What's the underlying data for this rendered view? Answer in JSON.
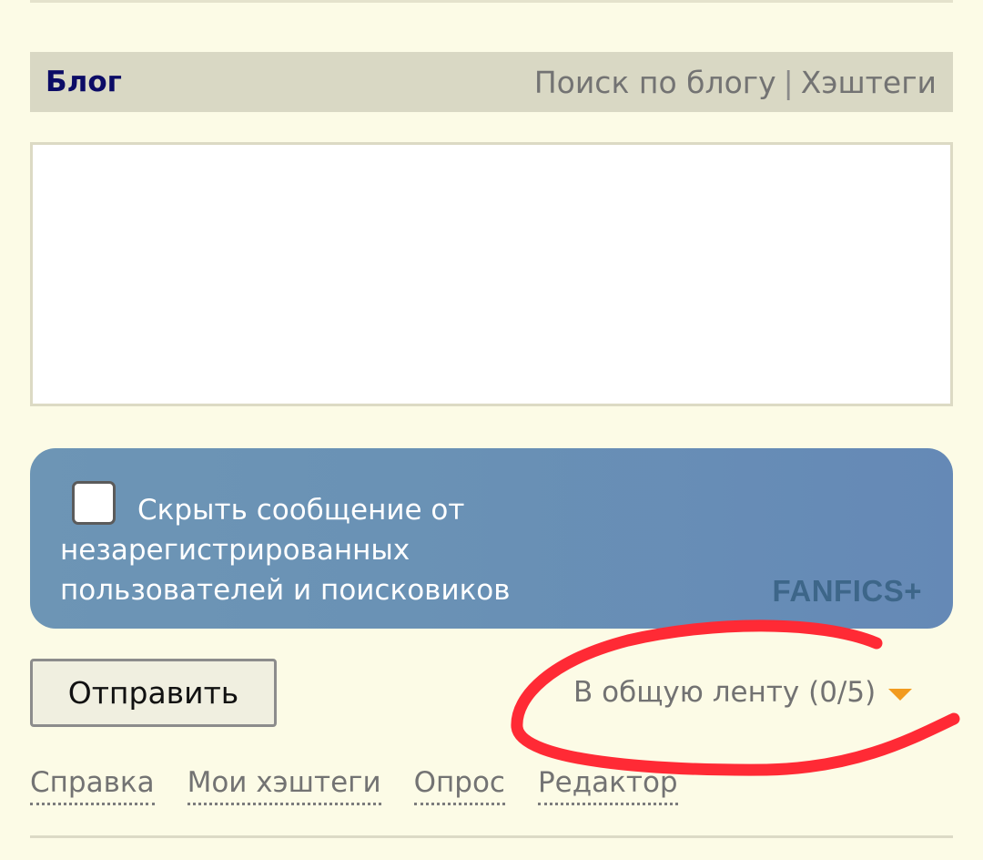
{
  "header": {
    "title": "Блог",
    "search_link": "Поиск по блогу",
    "separator": "|",
    "hashtags_link": "Хэштеги"
  },
  "composer": {
    "message_value": "",
    "hide_checkbox_checked": false,
    "hide_label": "Скрыть сообщение от незарегистрированных пользователей и поисковиков",
    "brand": "FANFICS+"
  },
  "actions": {
    "send_label": "Отправить",
    "feed_label": "В общую ленту (0/5)",
    "feed_caret_icon": "caret-down-icon"
  },
  "footer": {
    "links": [
      "Справка",
      "Мои хэштеги",
      "Опрос",
      "Редактор"
    ]
  },
  "colors": {
    "background": "#fcfbe6",
    "header_bar": "#d9d8c4",
    "title": "#0c0c66",
    "promo_panel": "#6a92b5",
    "brand_text": "#3d6689",
    "caret": "#f29b1f",
    "annotation_stroke": "#ff2a35"
  }
}
